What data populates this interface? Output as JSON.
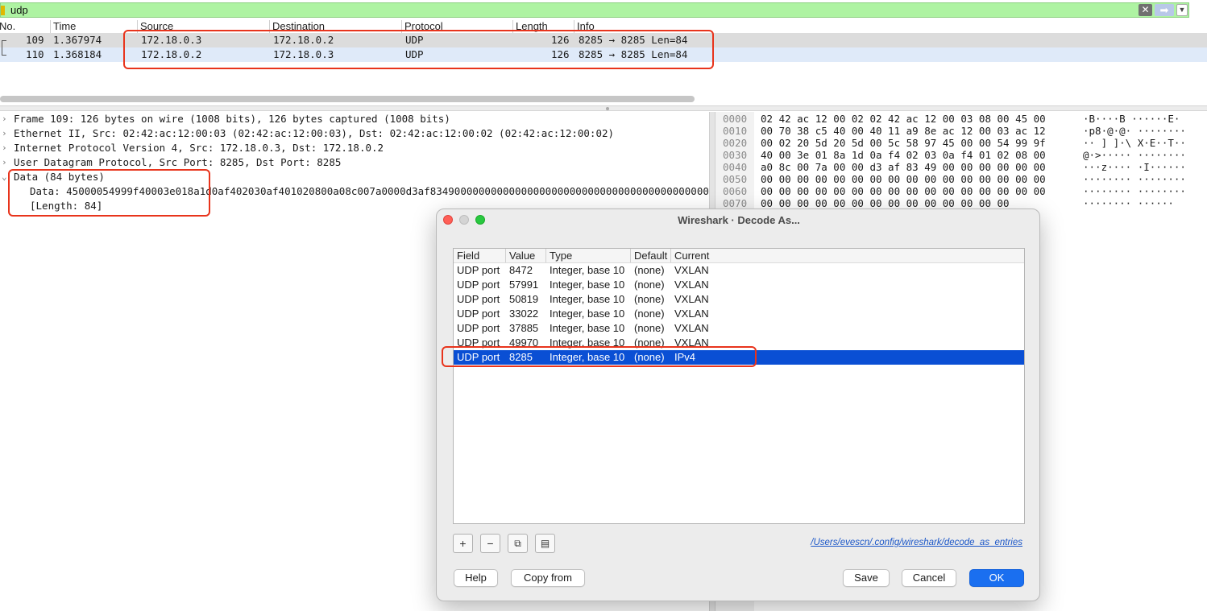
{
  "filter": {
    "value": "udp"
  },
  "packet_list": {
    "columns": [
      "No.",
      "Time",
      "Source",
      "Destination",
      "Protocol",
      "Length",
      "Info"
    ],
    "rows": [
      {
        "no": "109",
        "time": "1.367974",
        "source": "172.18.0.3",
        "destination": "172.18.0.2",
        "protocol": "UDP",
        "length": "126",
        "info": "8285 → 8285 Len=84"
      },
      {
        "no": "110",
        "time": "1.368184",
        "source": "172.18.0.2",
        "destination": "172.18.0.3",
        "protocol": "UDP",
        "length": "126",
        "info": "8285 → 8285 Len=84"
      }
    ]
  },
  "details": {
    "frame": "Frame 109: 126 bytes on wire (1008 bits), 126 bytes captured (1008 bits)",
    "ethernet": "Ethernet II, Src: 02:42:ac:12:00:03 (02:42:ac:12:00:03), Dst: 02:42:ac:12:00:02 (02:42:ac:12:00:02)",
    "ip": "Internet Protocol Version 4, Src: 172.18.0.3, Dst: 172.18.0.2",
    "udp": "User Datagram Protocol, Src Port: 8285, Dst Port: 8285",
    "data": "Data (84 bytes)",
    "data_value": "Data: 45000054999f40003e018a1d0af402030af401020800a08c007a0000d3af8349000000000000000000000000000000000000000000",
    "data_length": "[Length: 84]"
  },
  "bytes": [
    {
      "offset": "0000",
      "hex": "02 42 ac 12 00 02 02 42  ac 12 00 03 08 00 45 00",
      "ascii": "·B····B ······E·"
    },
    {
      "offset": "0010",
      "hex": "00 70 38 c5 40 00 40 11  a9 8e ac 12 00 03 ac 12",
      "ascii": "·p8·@·@· ········"
    },
    {
      "offset": "0020",
      "hex": "00 02 20 5d 20 5d 00 5c  58 97 45 00 00 54 99 9f",
      "ascii": "·· ] ]·\\ X·E··T··"
    },
    {
      "offset": "0030",
      "hex": "40 00 3e 01 8a 1d 0a f4  02 03 0a f4 01 02 08 00",
      "ascii": "@·>····· ········"
    },
    {
      "offset": "0040",
      "hex": "a0 8c 00 7a 00 00 d3 af  83 49 00 00 00 00 00 00",
      "ascii": "···z···· ·I······"
    },
    {
      "offset": "0050",
      "hex": "00 00 00 00 00 00 00 00  00 00 00 00 00 00 00 00",
      "ascii": "········ ········"
    },
    {
      "offset": "0060",
      "hex": "00 00 00 00 00 00 00 00  00 00 00 00 00 00 00 00",
      "ascii": "········ ········"
    },
    {
      "offset": "0070",
      "hex": "00 00 00 00 00 00 00 00  00 00 00 00 00 00",
      "ascii": "········ ······"
    }
  ],
  "dialog": {
    "title": "Wireshark · Decode As...",
    "columns": [
      "Field",
      "Value",
      "Type",
      "Default",
      "Current"
    ],
    "rows": [
      {
        "field": "UDP port",
        "value": "8472",
        "type": "Integer, base 10",
        "default": "(none)",
        "current": "VXLAN"
      },
      {
        "field": "UDP port",
        "value": "57991",
        "type": "Integer, base 10",
        "default": "(none)",
        "current": "VXLAN"
      },
      {
        "field": "UDP port",
        "value": "50819",
        "type": "Integer, base 10",
        "default": "(none)",
        "current": "VXLAN"
      },
      {
        "field": "UDP port",
        "value": "33022",
        "type": "Integer, base 10",
        "default": "(none)",
        "current": "VXLAN"
      },
      {
        "field": "UDP port",
        "value": "37885",
        "type": "Integer, base 10",
        "default": "(none)",
        "current": "VXLAN"
      },
      {
        "field": "UDP port",
        "value": "49970",
        "type": "Integer, base 10",
        "default": "(none)",
        "current": "VXLAN"
      },
      {
        "field": "UDP port",
        "value": "8285",
        "type": "Integer, base 10",
        "default": "(none)",
        "current": "IPv4"
      }
    ],
    "selected_row": 6,
    "toolbar": {
      "add": "+",
      "remove": "−",
      "copy": "⧉",
      "clear": "▤"
    },
    "path": "/Users/evescn/.config/wireshark/decode_as_entries",
    "buttons": {
      "help": "Help",
      "copy_from": "Copy from",
      "save": "Save",
      "cancel": "Cancel",
      "ok": "OK"
    }
  },
  "colors": {
    "highlight": "#e8341c",
    "selection": "#0a4fd4",
    "filter_bg": "#aef3a2"
  }
}
